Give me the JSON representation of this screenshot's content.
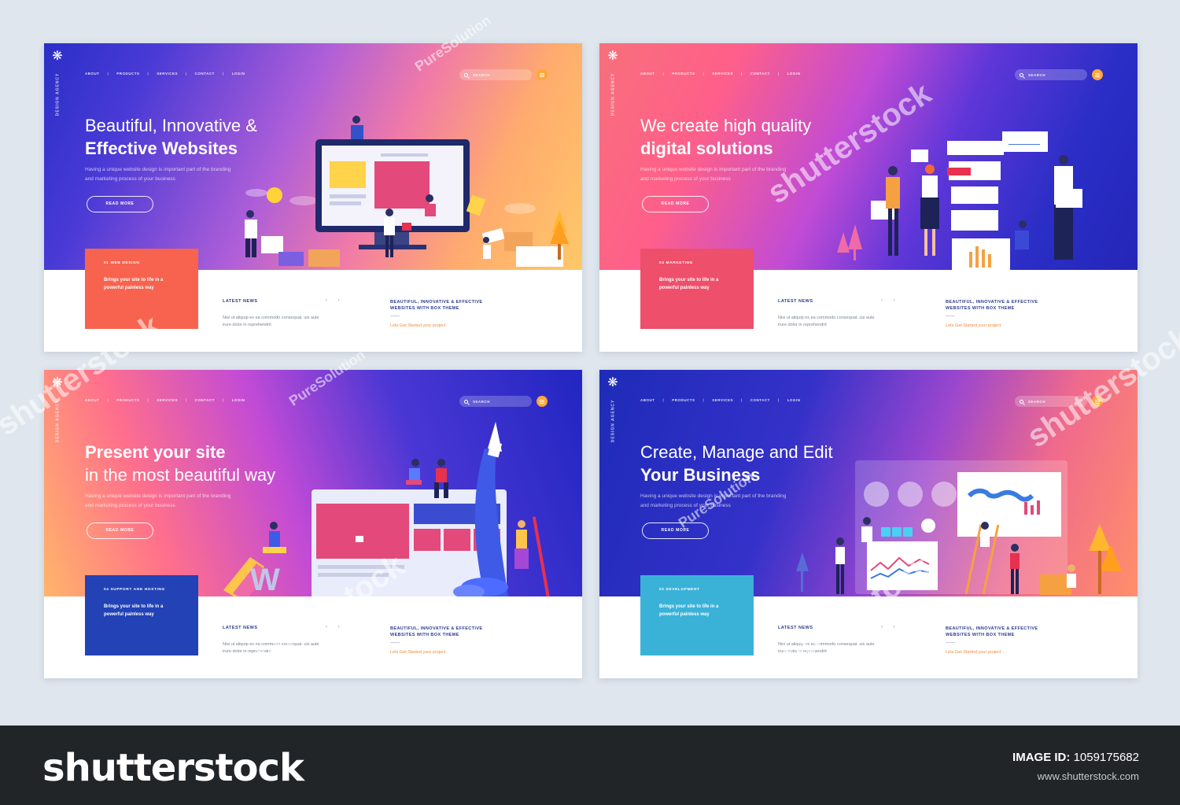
{
  "panels": [
    {
      "agency": "DESIGN AGENCY",
      "nav": [
        "ABOUT",
        "PRODUCTS",
        "SERVICES",
        "CONTACT",
        "LOGIN"
      ],
      "search_placeholder": "SEARCH",
      "headline_line1": "Beautiful, Innovative &",
      "headline_line2": "Effective Websites",
      "description": "Having a unique website design is important part of the branding and marketing process of your business",
      "read_more": "READ MORE",
      "feature_title": "01 WEB DESIGN",
      "feature_text": "Brings your site to life in a powerful painless way",
      "feature_color": "#f7634f",
      "news_title": "LATEST NEWS",
      "news_arrows": "‹ ›",
      "news_text": "Nisi ut aliquip ex ea commodo consequat. uis aute irure dolor in reprehendrit",
      "theme_title": "BEAUTIFUL, INNOVATIVE & EFFECTIVE WEBSITES WITH BOX THEME",
      "theme_link": "Lets Get Started your project"
    },
    {
      "agency": "DESIGN AGENCY",
      "nav": [
        "ABOUT",
        "PRODUCTS",
        "SERVICES",
        "CONTACT",
        "LOGIN"
      ],
      "search_placeholder": "SEARCH",
      "headline_line1": "We create high quality",
      "headline_line2": "digital solutions",
      "description": "Having a unique website design is important part of the branding and marketing process of your business",
      "read_more": "READ MORE",
      "feature_title": "03 MARKETING",
      "feature_text": "Brings your site to life in a powerful painless way",
      "feature_color": "#ee4f6a",
      "news_title": "LATEST NEWS",
      "news_arrows": "‹ ›",
      "news_text": "Nisi ut aliquip ex ea commodo consequat. uis aute irure dolor in reprehendrit",
      "theme_title": "BEAUTIFUL, INNOVATIVE & EFFECTIVE WEBSITES WITH BOX THEME",
      "theme_link": "Lets Get Started your project"
    },
    {
      "agency": "DESIGN AGENCY",
      "nav": [
        "ABOUT",
        "PRODUCTS",
        "SERVICES",
        "CONTACT",
        "LOGIN"
      ],
      "search_placeholder": "SEARCH",
      "headline_line1": "Present your site",
      "headline_line2": "in the most beautiful way",
      "description": "Having a unique website design is important part of the branding and marketing process of your business",
      "read_more": "READ MORE",
      "feature_title": "04 SUPPORT AND HOSTING",
      "feature_text": "Brings your site to life in a powerful painless way",
      "feature_color": "#2242b6",
      "news_title": "LATEST NEWS",
      "news_arrows": "‹ ›",
      "news_text": "Nisi ut aliquip ex ea commodo consequat. uis aute irure dolor in reprehendrit",
      "theme_title": "BEAUTIFUL, INNOVATIVE & EFFECTIVE WEBSITES WITH BOX THEME",
      "theme_link": "Lets Get Started your project"
    },
    {
      "agency": "DESIGN AGENCY",
      "nav": [
        "ABOUT",
        "PRODUCTS",
        "SERVICES",
        "CONTACT",
        "LOGIN"
      ],
      "search_placeholder": "SEARCH",
      "headline_line1": "Create, Manage and Edit",
      "headline_line2": "Your Business",
      "description": "Having a unique website design is important part of the branding and marketing process of your business",
      "read_more": "READ MORE",
      "feature_title": "02 DEVELOPMENT",
      "feature_text": "Brings your site to life in a powerful painless way",
      "feature_color": "#3ab2d8",
      "news_title": "LATEST NEWS",
      "news_arrows": "‹ ›",
      "news_text": "Nisi ut aliquip ex ea commodo consequat. uis aute irure dolor in reprehendrit",
      "theme_title": "BEAUTIFUL, INNOVATIVE & EFFECTIVE WEBSITES WITH BOX THEME",
      "theme_link": "Lets Get Started your project"
    }
  ],
  "footer": {
    "brand": "shutterstock",
    "image_id_label": "IMAGE ID:",
    "image_id": "1059175682",
    "url": "www.shutterstock.com"
  },
  "watermarks": {
    "shutterstock": "shutterstock",
    "puresolution": "PureSolution"
  }
}
